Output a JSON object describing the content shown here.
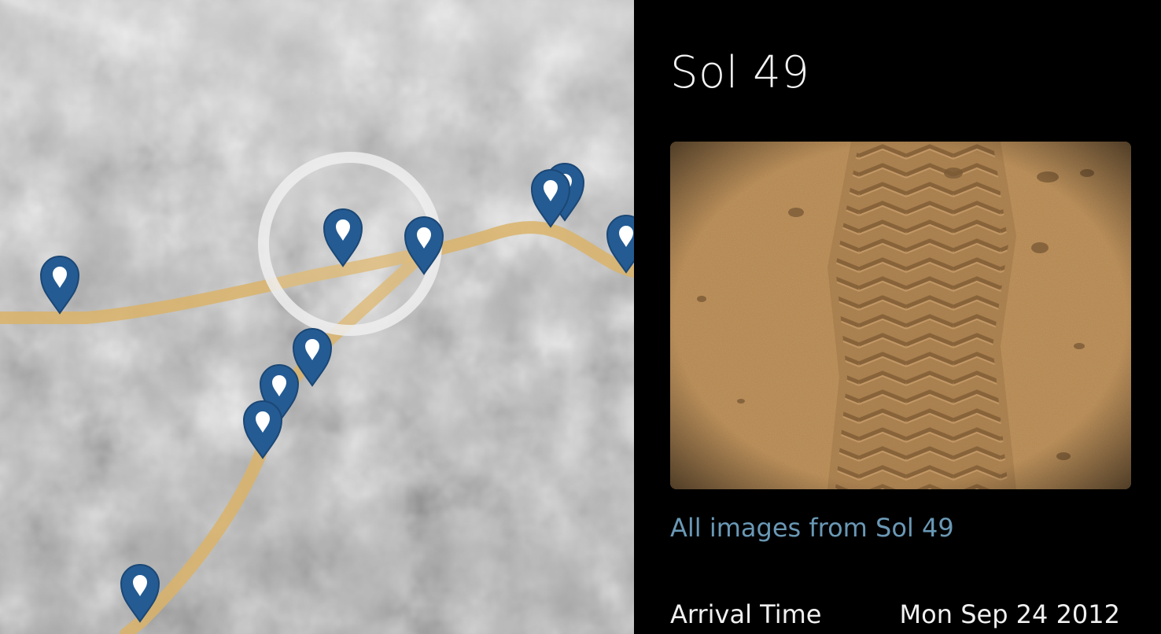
{
  "map": {
    "pins": [
      {
        "name": "waypoint"
      },
      {
        "name": "waypoint"
      },
      {
        "name": "waypoint"
      },
      {
        "name": "waypoint"
      },
      {
        "name": "waypoint"
      },
      {
        "name": "waypoint"
      },
      {
        "name": "waypoint"
      },
      {
        "name": "waypoint"
      },
      {
        "name": "waypoint"
      },
      {
        "name": "waypoint"
      }
    ],
    "route_color": "#d9b36a",
    "pin_color": "#245b93"
  },
  "panel": {
    "title": "Sol 49",
    "image_alt_icon": "rover-track-photo",
    "all_images_link": "All images from Sol 49",
    "arrival_label": "Arrival Time",
    "arrival_value": "Mon Sep 24 2012"
  }
}
